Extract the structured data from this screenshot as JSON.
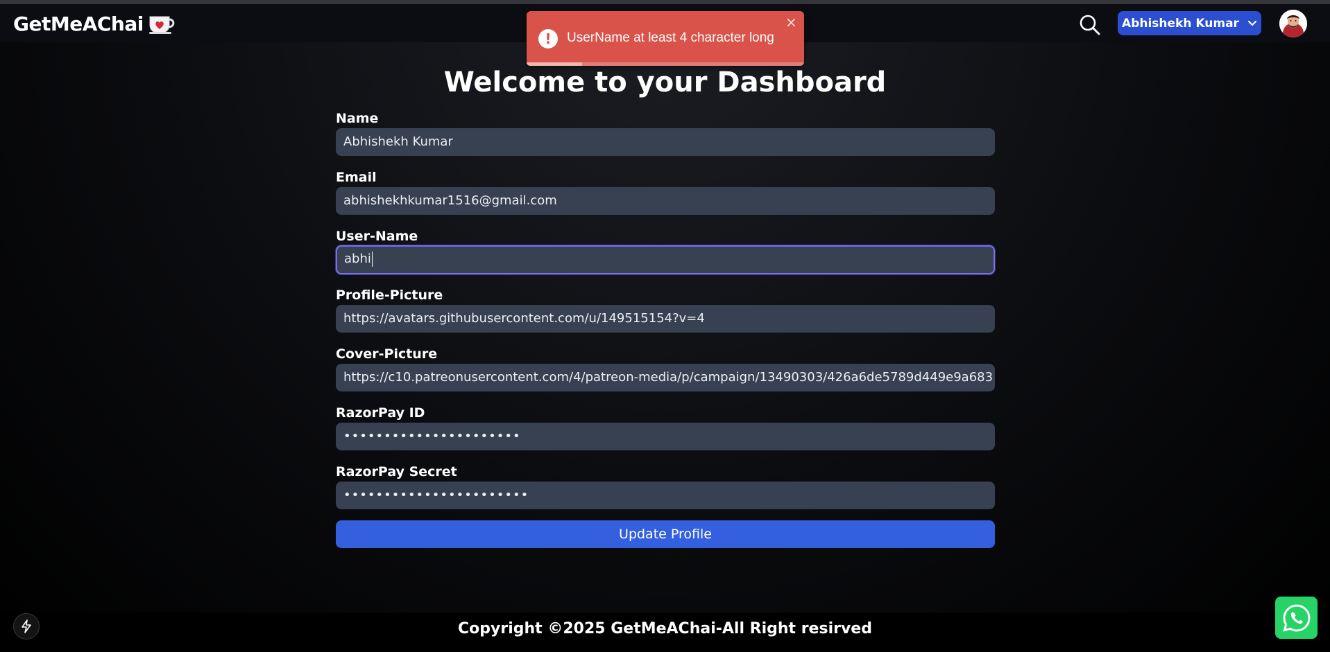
{
  "brand": {
    "name": "GetMeAChai",
    "logo_icon": "tea-cup-heart-icon"
  },
  "header": {
    "search_icon": "search-icon",
    "user_menu_label": "Abhishekh Kumar",
    "user_menu_icon": "chevron-down-icon",
    "avatar_icon": "avatar"
  },
  "toast": {
    "message": "UserName at least 4 character long",
    "icon": "exclamation-icon",
    "close_label": "×",
    "progress": 0.2,
    "color": "#d9534a"
  },
  "page": {
    "title": "Welcome to your Dashboard"
  },
  "form": {
    "name": {
      "label": "Name",
      "value": "Abhishekh Kumar"
    },
    "email": {
      "label": "Email",
      "value": "abhishekhkumar1516@gmail.com"
    },
    "username": {
      "label": "User-Name",
      "value": "abhi"
    },
    "profile_picture": {
      "label": "Profile-Picture",
      "value": "https://avatars.githubusercontent.com/u/149515154?v=4"
    },
    "cover_picture": {
      "label": "Cover-Picture",
      "value": "https://c10.patreonusercontent.com/4/patreon-media/p/campaign/13490303/426a6de5789d449e9a683"
    },
    "razorpay_id": {
      "label": "RazorPay ID",
      "value": "••••••••••••••••••••••"
    },
    "razorpay_secret": {
      "label": "RazorPay Secret",
      "value": "•••••••••••••••••••••••"
    },
    "submit_label": "Update Profile"
  },
  "footer": {
    "text": "Copyright ©2025 GetMeAChai-All Right resirved"
  },
  "widgets": {
    "bolt_icon": "lightning-icon",
    "whatsapp_icon": "whatsapp-icon"
  },
  "colors": {
    "accent": "#2b4fd0",
    "submit": "#3460e0",
    "field_bg": "#374151",
    "focus_ring": "#7c6cf0"
  }
}
